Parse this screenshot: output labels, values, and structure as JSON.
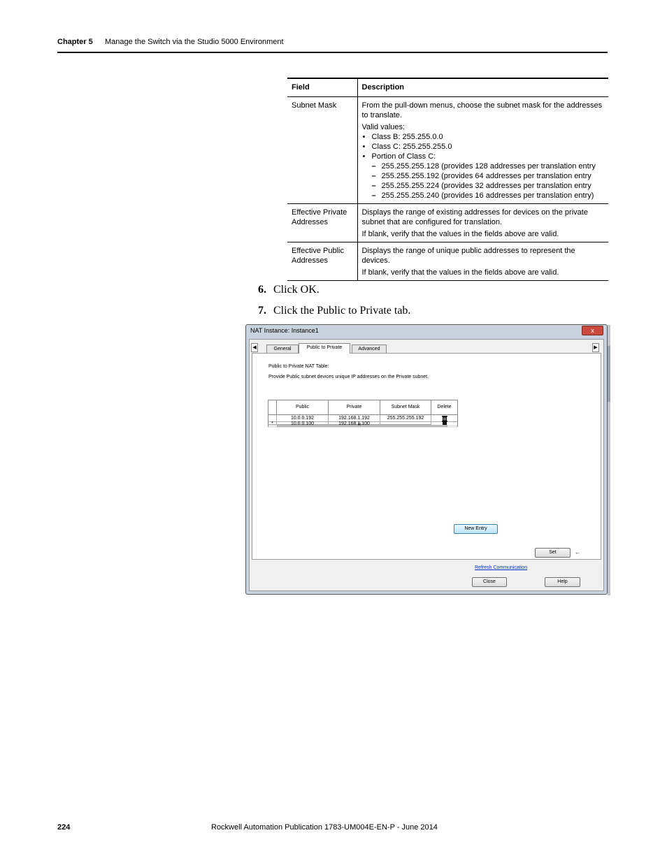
{
  "header": {
    "chapter": "Chapter 5",
    "title": "Manage the Switch via the Studio 5000 Environment"
  },
  "table": {
    "headers": [
      "Field",
      "Description"
    ],
    "subnet_mask": {
      "field": "Subnet Mask",
      "intro": "From the pull-down menus, choose the subnet mask for the addresses to translate.",
      "valid": "Valid values:",
      "bullets": [
        "Class B: 255.255.0.0",
        "Class C: 255.255.255.0",
        "Portion of Class C:"
      ],
      "dashes": [
        "255.255.255.128 (provides 128 addresses per translation entry",
        "255.255.255.192 (provides 64 addresses per translation entry",
        "255.255.255.224 (provides 32 addresses per translation entry",
        "255.255.255.240 (provides 16 addresses per translation entry)"
      ]
    },
    "private": {
      "field": "Effective Private Addresses",
      "desc": "Displays the range of existing addresses for devices on the private subnet that are configured for translation.",
      "note": "If blank, verify that the values in the fields above are valid."
    },
    "public": {
      "field": "Effective Public Addresses",
      "desc": "Displays the range of unique public addresses to represent the devices.",
      "note": "If blank, verify that the values in the fields above are valid."
    }
  },
  "steps": [
    {
      "num": "6.",
      "text": "Click OK."
    },
    {
      "num": "7.",
      "text": "Click the Public to Private tab."
    }
  ],
  "dialog": {
    "title": "NAT Instance: Instance1",
    "close": "x",
    "tabs": [
      "General",
      "Public to Private",
      "Advanced"
    ],
    "active_tab": "Public to Private",
    "nat_label": "Public to Private NAT Table:",
    "nat_desc": "Provide Public subnet devices unique IP addresses on the Private subnet.",
    "grid": {
      "columns": [
        "Public",
        "Private",
        "Subnet Mask",
        "Delete"
      ],
      "rows": [
        {
          "marker": "",
          "public": "10.0.0.192",
          "private": "192.168.1.192",
          "mask": "255.255.255.192"
        },
        {
          "marker": "*",
          "public": "10.0.0.100",
          "private": "192.168.1.100",
          "mask": ""
        }
      ],
      "scroll_grip": "III"
    },
    "new_entry": "New Entry",
    "refresh": "Refresh Communication",
    "set": "Set",
    "close_btn": "Close",
    "help": "Help"
  },
  "footer": {
    "page": "224",
    "publication": "Rockwell Automation Publication 1783-UM004E-EN-P - June 2014"
  }
}
